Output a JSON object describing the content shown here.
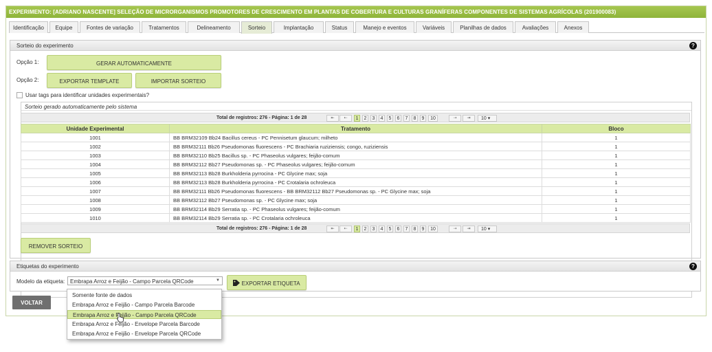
{
  "title": "EXPERIMENTO: [ADRIANO NASCENTE] SELEÇÃO DE MICRORGANISMOS PROMOTORES DE CRESCIMENTO EM PLANTAS DE COBERTURA E CULTURAS GRANÍFERAS COMPONENTES DE SISTEMAS AGRÍCOLAS (201900083)",
  "tabs": [
    {
      "label": "Identificação"
    },
    {
      "label": "Equipe"
    },
    {
      "label": "Fontes de variação"
    },
    {
      "label": "Tratamentos"
    },
    {
      "label": "Delineamento"
    },
    {
      "label": "Sorteio"
    },
    {
      "label": "Implantação"
    },
    {
      "label": "Status"
    },
    {
      "label": "Manejo e eventos"
    },
    {
      "label": "Variáveis"
    },
    {
      "label": "Planilhas de dados"
    },
    {
      "label": "Avaliações"
    },
    {
      "label": "Anexos"
    }
  ],
  "active_tab": "Sorteio",
  "sorteio": {
    "header": "Sorteio do experimento",
    "option1_label": "Opção 1:",
    "option2_label": "Opção 2:",
    "btn_auto": "GERAR AUTOMATICAMENTE",
    "btn_export_template": "EXPORTAR TEMPLATE",
    "btn_import": "IMPORTAR SORTEIO",
    "use_tags_label": "Usar tags para identificar unidades experimentais?",
    "use_tags_checked": false,
    "caption": "Sorteio gerado automaticamente pelo sistema",
    "pager": {
      "info": "Total de registros: 276 - Página: 1 de 28",
      "first": "⇤",
      "prev": "⇠",
      "pages": [
        "1",
        "2",
        "3",
        "4",
        "5",
        "6",
        "7",
        "8",
        "9",
        "10"
      ],
      "current_page": "1",
      "next": "⇢",
      "last": "⇥",
      "page_size": "10 ▾"
    },
    "columns": [
      "Unidade Experimental",
      "Tratamento",
      "Bloco"
    ],
    "rows": [
      [
        "1001",
        "BB BRM32109 Bb24 Bacillus cereus - PC Pennisetum glaucum; milheto",
        "1"
      ],
      [
        "1002",
        "BB BRM32111 Bb26 Pseudomonas fluorescens - PC Brachiaria ruziziensis; congo, ruziziensis",
        "1"
      ],
      [
        "1003",
        "BB BRM32110 Bb25 Bacillus sp. - PC Phaseolus vulgares; feijão-comum",
        "1"
      ],
      [
        "1004",
        "BB BRM32112 Bb27 Pseudomonas sp. - PC Phaseolus vulgares; feijão-comum",
        "1"
      ],
      [
        "1005",
        "BB BRM32113 Bb28 Burkholderia pyrrocina - PC Glycine max; soja",
        "1"
      ],
      [
        "1006",
        "BB BRM32113 Bb28 Burkholderia pyrrocina - PC Crotalaria ochroleuca",
        "1"
      ],
      [
        "1007",
        "BB BRM32111 Bb26 Pseudomonas fluorescens - BB BRM32112 Bb27 Pseudomonas sp. - PC Glycine max; soja",
        "1"
      ],
      [
        "1008",
        "BB BRM32112 Bb27 Pseudomonas sp. - PC Glycine max; soja",
        "1"
      ],
      [
        "1009",
        "BB BRM32114 Bb29 Serratia sp. - PC Phaseolus vulgares; feijão-comum",
        "1"
      ],
      [
        "1010",
        "BB BRM32114 Bb29 Serratia sp. - PC Crotalaria ochroleuca",
        "1"
      ]
    ],
    "btn_remove": "REMOVER SORTEIO"
  },
  "etiquetas": {
    "header": "Etiquetas do experimento",
    "model_label": "Modelo da etiqueta:",
    "model_value": "Embrapa Arroz e Feijão - Campo Parcela QRCode",
    "btn_export": "EXPORTAR ETIQUETA",
    "options": [
      "Somente fonte de dados",
      "Embrapa Arroz e Feijão - Campo Parcela Barcode",
      "Embrapa Arroz e Feijão - Campo Parcela QRCode",
      "Embrapa Arroz e Feijão - Envelope Parcela Barcode",
      "Embrapa Arroz e Feijão - Envelope Parcela QRCode"
    ],
    "selected_option": "Embrapa Arroz e Feijão - Campo Parcela QRCode"
  },
  "btn_voltar": "VOLTAR",
  "help_glyph": "?",
  "icons": {
    "help": "help-circle-icon",
    "tag": "tag-icon",
    "cursor": "hand-pointer-icon"
  },
  "colors": {
    "accent_green": "#8eb43a",
    "button_green": "#d9eaa3",
    "dark_button": "#6f6f6f"
  }
}
